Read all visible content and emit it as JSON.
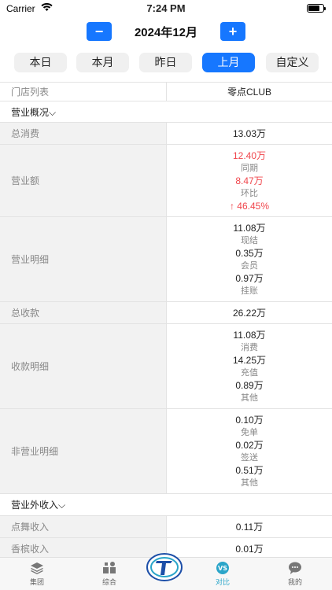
{
  "status": {
    "carrier": "Carrier",
    "time": "7:24 PM"
  },
  "month_nav": {
    "prev": "−",
    "label": "2024年12月",
    "next": "+"
  },
  "period_tabs": [
    "本日",
    "本月",
    "昨日",
    "上月",
    "自定义"
  ],
  "active_period": "上月",
  "store_header": {
    "label": "门店列表",
    "value": "零点CLUB"
  },
  "section_overview": "营业概况⌵",
  "total_consumption": {
    "label": "总消费",
    "value": "13.03万"
  },
  "revenue": {
    "label": "营业额",
    "value": "12.40万",
    "yoy_label": "同期",
    "yoy_value": "8.47万",
    "mom_label": "环比",
    "mom_value": "↑ 46.45%"
  },
  "revenue_detail": {
    "label": "营业明细",
    "items": [
      {
        "value": "11.08万",
        "name": "现结"
      },
      {
        "value": "0.35万",
        "name": "会员"
      },
      {
        "value": "0.97万",
        "name": "挂账"
      }
    ]
  },
  "total_received": {
    "label": "总收款",
    "value": "26.22万"
  },
  "receipt_detail": {
    "label": "收款明细",
    "items": [
      {
        "value": "11.08万",
        "name": "消费"
      },
      {
        "value": "14.25万",
        "name": "充值"
      },
      {
        "value": "0.89万",
        "name": "其他"
      }
    ]
  },
  "non_revenue_detail": {
    "label": "非营业明细",
    "items": [
      {
        "value": "0.10万",
        "name": "免单"
      },
      {
        "value": "0.02万",
        "name": "签送"
      },
      {
        "value": "0.51万",
        "name": "其他"
      }
    ]
  },
  "section_extra": "营业外收入⌵",
  "dance_income": {
    "label": "点舞收入",
    "value": "0.11万"
  },
  "champagne_income": {
    "label": "香槟收入",
    "value": "0.01万"
  },
  "tab_bar": [
    {
      "label": "集团",
      "icon": "layers-icon"
    },
    {
      "label": "综合",
      "icon": "grid-icon"
    },
    {
      "label": "",
      "icon": "logo-icon"
    },
    {
      "label": "对比",
      "icon": "vs-icon"
    },
    {
      "label": "我的",
      "icon": "chat-icon"
    }
  ],
  "colors": {
    "accent": "#1677ff",
    "highlight": "#f0464c",
    "active_tab": "#2aa5c9"
  }
}
